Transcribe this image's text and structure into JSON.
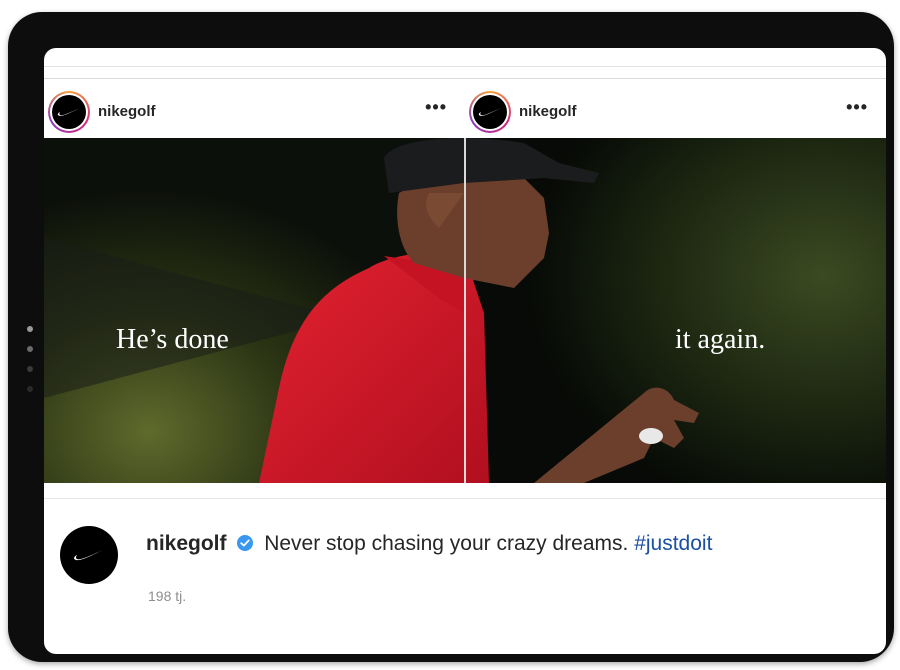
{
  "posts": [
    {
      "username": "nikegolf",
      "more_label": "•••",
      "overlay_text": "He’s done"
    },
    {
      "username": "nikegolf",
      "more_label": "•••",
      "overlay_text": "it again."
    }
  ],
  "caption": {
    "username": "nikegolf",
    "text": "Never stop chasing your crazy dreams.",
    "hashtag": "#justdoit",
    "timestamp": "198 tj."
  },
  "icons": {
    "avatar": "nike-swoosh-icon",
    "verified": "verified-badge-icon",
    "more": "more-options-icon"
  },
  "colors": {
    "hashtag": "#1a4fa3",
    "verified": "#3897f0",
    "shirt": "#d4182a"
  }
}
